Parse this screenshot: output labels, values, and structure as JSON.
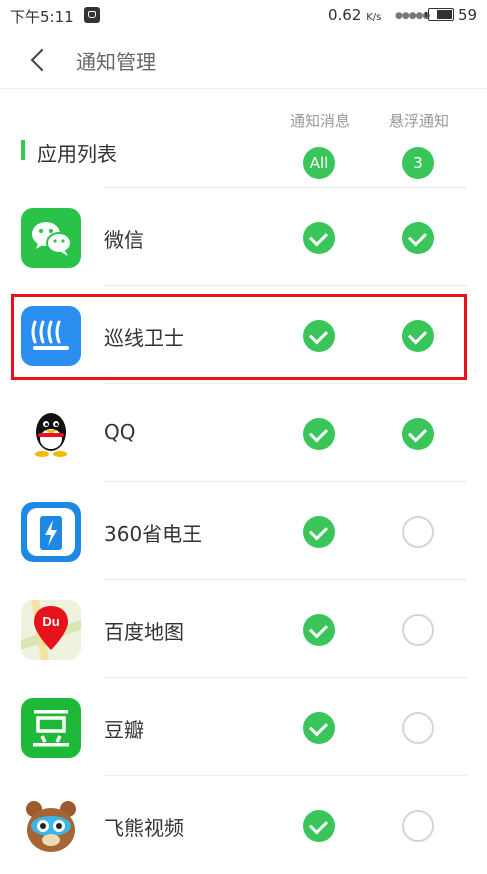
{
  "status_bar": {
    "time": "下午5:11",
    "speed": "0.62",
    "speed_unit": "K/s",
    "battery_level": "59"
  },
  "header": {
    "title": "通知管理"
  },
  "section": {
    "label": "应用列表",
    "col_notify": "通知消息",
    "col_float": "悬浮通知",
    "badge_notify": "All",
    "badge_float": "3"
  },
  "apps": [
    {
      "name": "微信",
      "icon": "wechat-icon",
      "notify": true,
      "float": true
    },
    {
      "name": "巡线卫士",
      "icon": "patrol-icon",
      "notify": true,
      "float": true
    },
    {
      "name": "QQ",
      "icon": "qq-icon",
      "notify": true,
      "float": true
    },
    {
      "name": "360省电王",
      "icon": "battery-saver-icon",
      "notify": true,
      "float": false
    },
    {
      "name": "百度地图",
      "icon": "baidu-map-icon",
      "notify": true,
      "float": false
    },
    {
      "name": "豆瓣",
      "icon": "douban-icon",
      "notify": true,
      "float": false
    },
    {
      "name": "飞熊视频",
      "icon": "feixiong-video-icon",
      "notify": true,
      "float": false
    }
  ],
  "colors": {
    "accent": "#3ac55b",
    "highlight": "#e8121a"
  }
}
